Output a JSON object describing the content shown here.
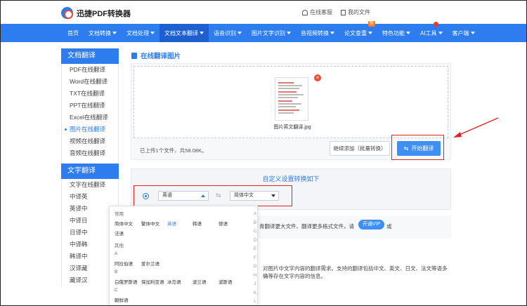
{
  "header": {
    "logo_text": "迅捷PDF转换器",
    "links": [
      "在线客服",
      "我的文件"
    ]
  },
  "nav": {
    "items": [
      {
        "label": "首页",
        "dropdown": false
      },
      {
        "label": "文档转换",
        "dropdown": true
      },
      {
        "label": "文档处理",
        "dropdown": true
      },
      {
        "label": "文档文本翻译",
        "dropdown": true,
        "active": true
      },
      {
        "label": "语音识别",
        "dropdown": true
      },
      {
        "label": "图片文字识别",
        "dropdown": true
      },
      {
        "label": "音视频转换",
        "dropdown": true
      },
      {
        "label": "论文查重",
        "dropdown": true,
        "badge": "新"
      },
      {
        "label": "特色功能",
        "dropdown": true
      },
      {
        "label": "AI工具",
        "dropdown": true,
        "dot": true
      },
      {
        "label": "客户端",
        "dropdown": true
      }
    ]
  },
  "sidebar": {
    "section1_title": "文档翻译",
    "section1_items": [
      "PDF在线翻译",
      "Word在线翻译",
      "TXT在线翻译",
      "PPT在线翻译",
      "Excel在线翻译",
      "图片在线翻译",
      "视频在线翻译",
      "音频在线翻译"
    ],
    "active_index": 5,
    "section2_title": "文字翻译",
    "section2_items": [
      "文字在线翻译",
      "中译英",
      "英译中",
      "中译日",
      "日译中",
      "中译韩",
      "韩译中",
      "汉译藏",
      "藏译汉"
    ]
  },
  "main": {
    "page_title": "在线翻译图片",
    "file_name": "图片英文翻译.jpg",
    "upload_status": "已上传1个文件，共58.08K。",
    "continue_button": "继续添加（批量转换）",
    "start_button": "开始翻译",
    "settings_title": "自定义设置转换如下",
    "source_lang": "英语",
    "target_lang": "简体中文"
  },
  "vip": {
    "text": "青翻译更大文件、翻译更多格式文件，请",
    "button": "开通VIP",
    "tail": "或"
  },
  "description": [
    "对图片中文字内容的翻译需求。支持的翻译包括中文、英文、日文、法文等语多",
    "确等存在文字内容的信息。"
  ],
  "dropdown": {
    "groups": [
      {
        "label": "常用",
        "options": [
          "简体中文",
          "繁体中文",
          "英语",
          "韩语",
          "德语",
          "法语"
        ]
      },
      {
        "label": "其他",
        "options": []
      },
      {
        "label": "A",
        "options": [
          "阿拉伯语",
          "爱尔兰语"
        ]
      },
      {
        "label": "B",
        "options": [
          "白俄罗斯语",
          "保加利亚语",
          "冰岛语",
          "波兰语",
          "波斯语"
        ]
      },
      {
        "label": "C",
        "options": [
          "朝鲜语"
        ]
      }
    ],
    "selected": "英语",
    "alphabet": [
      "A",
      "B",
      "C",
      "D",
      "E",
      "F",
      "G",
      "H",
      "J",
      "K",
      "L",
      "M"
    ]
  },
  "colors": {
    "brand_blue": "#2d7cf0",
    "highlight_red": "#e02020"
  }
}
